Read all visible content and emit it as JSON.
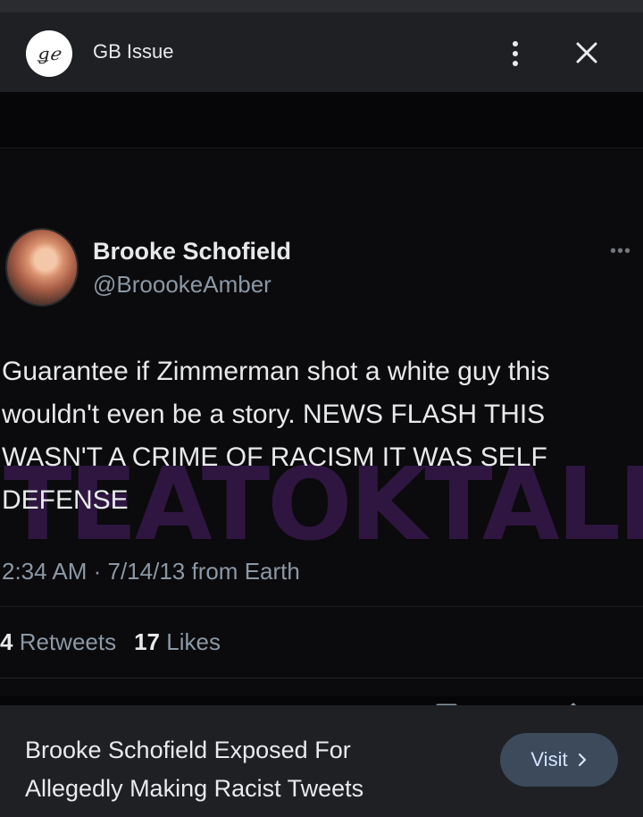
{
  "header": {
    "source_logo_text": "ǥℯ",
    "source_name": "GB Issue",
    "more_icon": "more-vert-icon",
    "close_icon": "close-icon"
  },
  "tweet": {
    "display_name": "Brooke Schofield",
    "handle": "@BroookeAmber",
    "text": "Guarantee if Zimmerman shot a white guy   this\nwouldn't even be a story. NEWS FLASH THIS\nWASN'T A CRIME OF RACISM IT WAS SELF\nDEFENSE",
    "watermark": "TEATOKTALK",
    "timestamp": "2:34 AM · 7/14/13 from Earth",
    "retweets_count": "4",
    "retweets_label": "Retweets",
    "likes_count": "17",
    "likes_label": "Likes",
    "actions": [
      "reply-icon",
      "retweet-icon",
      "like-icon",
      "bookmark-icon",
      "share-icon"
    ]
  },
  "footer": {
    "caption": "Brooke Schofield Exposed For Allegedly Making Racist Tweets",
    "visit_label": "Visit"
  },
  "colors": {
    "panel": "#1f2023",
    "watermark": "#2e1640",
    "visit_bg": "#3c4a5c"
  }
}
